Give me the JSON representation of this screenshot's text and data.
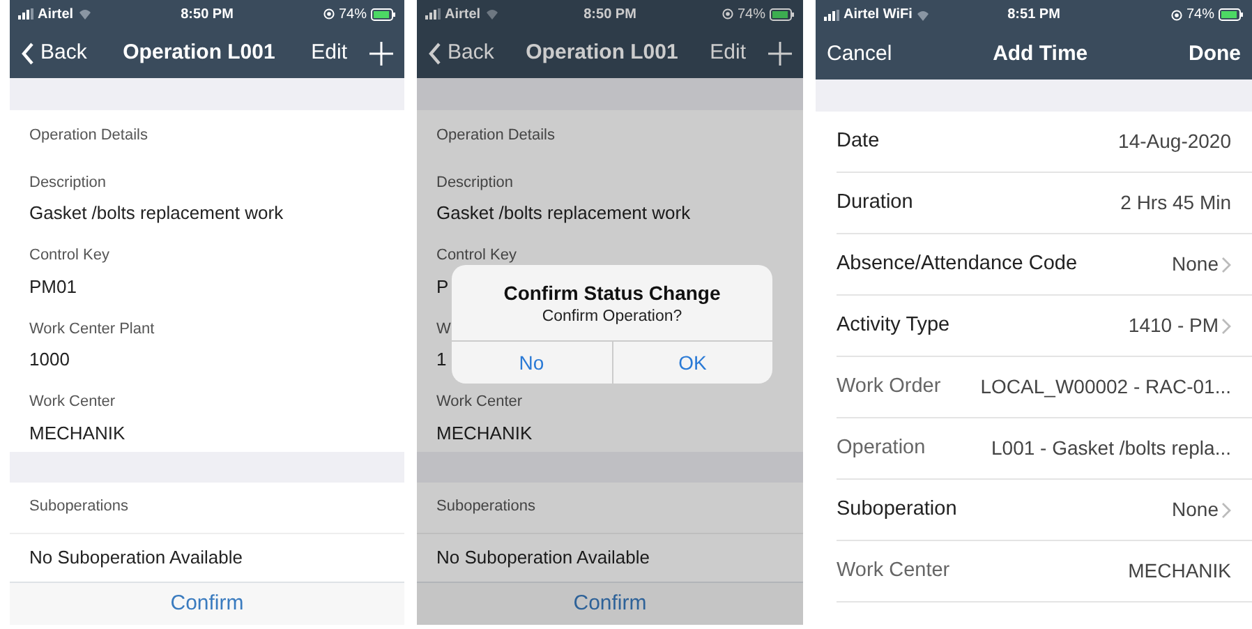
{
  "screens": [
    {
      "kind": "detail",
      "dimmed": false,
      "status_bar": {
        "carrier": "Airtel",
        "time": "8:50 PM",
        "battery": "74%"
      },
      "nav": {
        "left": "Back",
        "back_arrow": true,
        "title": "Operation L001",
        "right": "Edit",
        "add_button": true
      },
      "section_title": "Operation Details",
      "fields": [
        {
          "label": "Description",
          "value": "Gasket /bolts replacement work"
        },
        {
          "label": "Control Key",
          "value": "PM01"
        },
        {
          "label": "Work Center Plant",
          "value": "1000"
        },
        {
          "label": "Work Center",
          "value": "MECHANIK"
        }
      ],
      "subsection_title": "Suboperations",
      "subsection_text": "No Suboperation Available",
      "footer_button": "Confirm"
    },
    {
      "kind": "detail",
      "dimmed": true,
      "status_bar": {
        "carrier": "Airtel",
        "time": "8:50 PM",
        "battery": "74%"
      },
      "nav": {
        "left": "Back",
        "back_arrow": true,
        "title": "Operation L001",
        "right": "Edit",
        "add_button": true
      },
      "section_title": "Operation Details",
      "fields": [
        {
          "label": "Description",
          "value": "Gasket /bolts replacement work"
        },
        {
          "label": "Control Key",
          "value": "P"
        },
        {
          "label": "W",
          "value": "1"
        },
        {
          "label": "Work Center",
          "value": "MECHANIK"
        }
      ],
      "subsection_title": "Suboperations",
      "subsection_text": "No Suboperation Available",
      "footer_button": "Confirm",
      "alert": {
        "title": "Confirm Status Change",
        "message": "Confirm Operation?",
        "buttons": [
          "No",
          "OK"
        ]
      }
    },
    {
      "kind": "form",
      "dimmed": false,
      "status_bar": {
        "carrier": "Airtel WiFi",
        "time": "8:51 PM",
        "battery": "74%"
      },
      "nav": {
        "left": "Cancel",
        "back_arrow": false,
        "title": "Add Time",
        "right": "Done",
        "add_button": false
      },
      "rows": [
        {
          "label": "Date",
          "value": "14-Aug-2020",
          "editable": true,
          "chevron": false
        },
        {
          "label": "Duration",
          "value": "2 Hrs 45 Min",
          "editable": true,
          "chevron": false
        },
        {
          "label": "Absence/Attendance Code",
          "value": "None",
          "editable": true,
          "chevron": true
        },
        {
          "label": "Activity Type",
          "value": "1410 - PM",
          "editable": true,
          "chevron": true
        },
        {
          "label": "Work Order",
          "value": "LOCAL_W00002 - RAC-01...",
          "editable": false,
          "chevron": false
        },
        {
          "label": "Operation",
          "value": "L001 - Gasket /bolts repla...",
          "editable": false,
          "chevron": false
        },
        {
          "label": "Suboperation",
          "value": "None",
          "editable": true,
          "chevron": true
        },
        {
          "label": "Work Center",
          "value": "MECHANIK",
          "editable": false,
          "chevron": false
        }
      ]
    }
  ]
}
